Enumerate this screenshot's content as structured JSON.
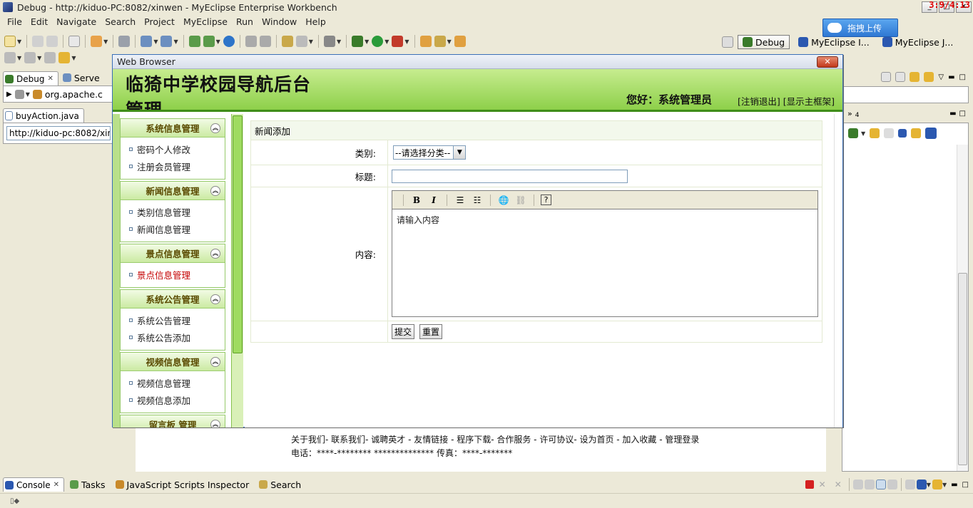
{
  "window": {
    "title": "Debug - http://kiduo-PC:8082/xinwen - MyEclipse Enterprise Workbench",
    "clock": "3:9/4:13"
  },
  "menubar": [
    "File",
    "Edit",
    "Navigate",
    "Search",
    "Project",
    "MyEclipse",
    "Run",
    "Window",
    "Help"
  ],
  "upload_button": "拖拽上传",
  "perspectives": [
    {
      "label": "Debug",
      "active": true
    },
    {
      "label": "MyEclipse I...",
      "active": false
    },
    {
      "label": "MyEclipse J...",
      "active": false
    }
  ],
  "left_views": {
    "tabs": [
      "Debug",
      "Serve"
    ],
    "tree_item": "org.apache.c",
    "editor_tab": "buyAction.java",
    "url": "http://kiduo-pc:8082/xinw"
  },
  "right_views": {
    "overflow_count": "4"
  },
  "background_page": {
    "footer_links": "关于我们- 联系我们- 诚聘英才 - 友情链接 - 程序下载- 合作服务 - 许可协议- 设为首页 - 加入收藏 - 管理登录",
    "footer_contact": "电话：****-******** ************** 传真：****-*******"
  },
  "bottom_tabs": [
    "Console",
    "Tasks",
    "JavaScript Scripts Inspector",
    "Search"
  ],
  "browser": {
    "title": "Web Browser",
    "site_title": "临猗中学校园导航后台管理",
    "greeting": "您好：系统管理员",
    "links": [
      "[注销退出]",
      "[显示主框架]"
    ],
    "menu_groups": [
      {
        "title": "系统信息管理",
        "items": [
          "密码个人修改",
          "注册会员管理"
        ]
      },
      {
        "title": "新闻信息管理",
        "items": [
          "类别信息管理",
          "新闻信息管理"
        ]
      },
      {
        "title": "景点信息管理",
        "items": [
          "景点信息管理"
        ]
      },
      {
        "title": "系统公告管理",
        "items": [
          "系统公告管理",
          "系统公告添加"
        ]
      },
      {
        "title": "视频信息管理",
        "items": [
          "视频信息管理",
          "视频信息添加"
        ]
      },
      {
        "title": "留言板   管理",
        "items": []
      }
    ],
    "form": {
      "caption": "新闻添加",
      "category_label": "类别:",
      "category_selected": "--请选择分类--",
      "title_label": "标题:",
      "title_value": "",
      "content_label": "内容:",
      "editor_placeholder": "请输入内容",
      "editor_buttons": [
        "B",
        "I"
      ],
      "submit_label": "提交",
      "reset_label": "重置"
    }
  },
  "colors": {
    "header_green": "#8ed04a",
    "header_border": "#3f8d18",
    "active_link": "#c40000",
    "upload_blue": "#2f78d3"
  }
}
